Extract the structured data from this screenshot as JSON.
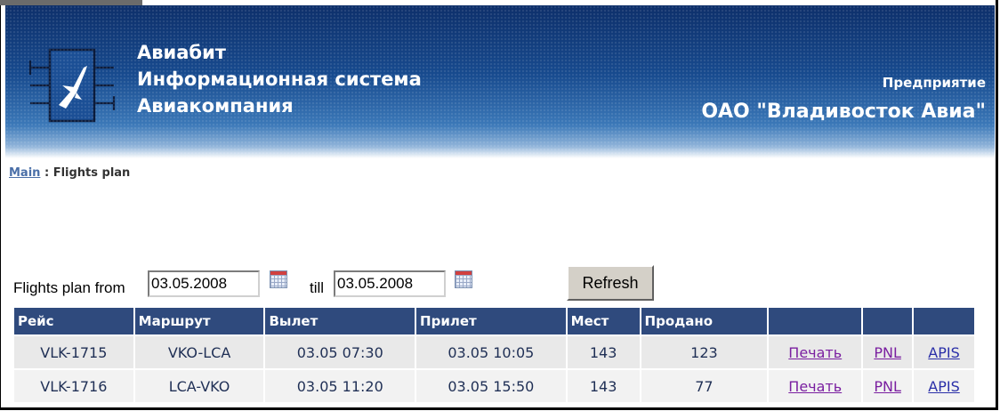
{
  "header": {
    "app_line1": "Авиабит",
    "app_line2": "Информационная система",
    "app_line3": "Авиакомпания",
    "company_label": "Предприятие",
    "company_name": "ОАО \"Владивосток Авиа\"",
    "logo_icon": "airplane-logo-icon",
    "colors": {
      "header_dark": "#0d2f6a",
      "header_light": "#3b78b8"
    }
  },
  "breadcrumb": {
    "main_link": "Main",
    "separator": " : ",
    "current": "Flights plan"
  },
  "filter": {
    "from_label": "Flights plan from",
    "from_value": "03.05.2008",
    "till_label": "till",
    "till_value": "03.05.2008",
    "calendar_icon": "calendar-icon",
    "refresh_label": "Refresh"
  },
  "table": {
    "columns": [
      "Рейс",
      "Маршрут",
      "Вылет",
      "Прилет",
      "Мест",
      "Продано",
      "",
      "",
      ""
    ],
    "rows": [
      {
        "flight": "VLK-1715",
        "route": "VKO-LCA",
        "departure": "03.05 07:30",
        "arrival": "03.05 10:05",
        "seats": "143",
        "sold": "123",
        "print": "Печать",
        "pnl": "PNL",
        "apis": "APIS"
      },
      {
        "flight": "VLK-1716",
        "route": "LCA-VKO",
        "departure": "03.05 11:20",
        "arrival": "03.05 15:50",
        "seats": "143",
        "sold": "77",
        "print": "Печать",
        "pnl": "PNL",
        "apis": "APIS"
      }
    ],
    "colors": {
      "header_bg": "#2f4a7d",
      "link_visited": "#7a1fa0",
      "link": "#2a2fa8"
    }
  }
}
